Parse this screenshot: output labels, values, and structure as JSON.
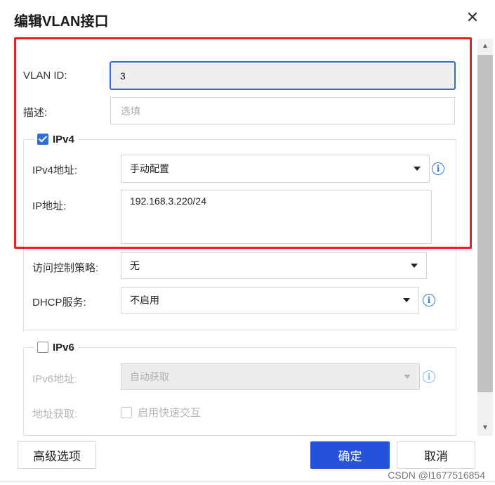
{
  "dialog": {
    "title": "编辑VLAN接口",
    "close_glyph": "✕"
  },
  "vlan_id": {
    "label": "VLAN ID:",
    "value": "3"
  },
  "description": {
    "label": "描述:",
    "placeholder": "选填"
  },
  "ipv4": {
    "legend": "IPv4",
    "checked": true,
    "address_mode": {
      "label": "IPv4地址:",
      "value": "手动配置",
      "info_icon": "info-icon"
    },
    "ip_address": {
      "label": "IP地址:",
      "value": "192.168.3.220/24"
    },
    "acl": {
      "label": "访问控制策略:",
      "value": "无"
    },
    "dhcp": {
      "label": "DHCP服务:",
      "value": "不启用",
      "info_icon": "info-icon"
    }
  },
  "ipv6": {
    "legend": "IPv6",
    "checked": false,
    "address_mode": {
      "label": "IPv6地址:",
      "value": "自动获取",
      "info_icon": "info-icon"
    },
    "address_acquire": {
      "label": "地址获取:",
      "option": "启用快速交互",
      "checked": false
    }
  },
  "footer": {
    "advanced_label": "高级选项",
    "confirm_label": "确定",
    "cancel_label": "取消"
  },
  "colors": {
    "primary": "#2453d9",
    "highlight": "#e8201e",
    "info": "#2f7bd8"
  },
  "watermark": "CSDN @l1677516854"
}
